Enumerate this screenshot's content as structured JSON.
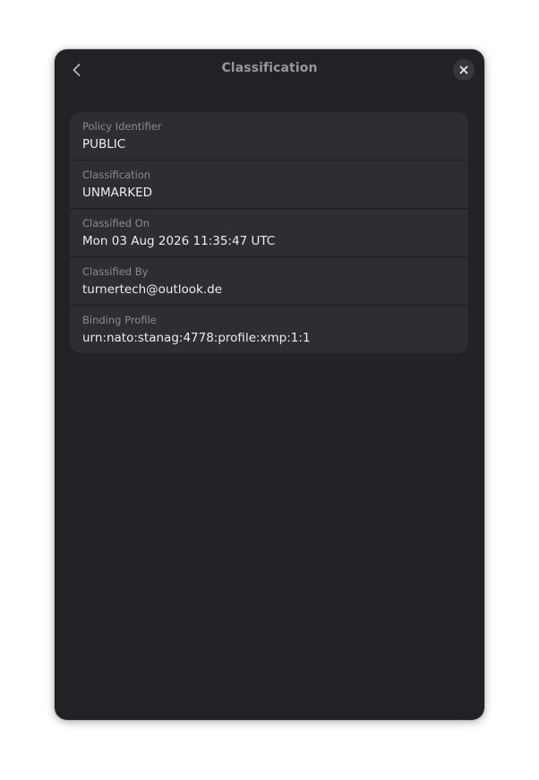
{
  "dialog": {
    "title": "Classification",
    "back_icon": "chevron-left-icon",
    "close_icon": "close-icon"
  },
  "rows": [
    {
      "label": "Policy Identifier",
      "value": "PUBLIC"
    },
    {
      "label": "Classification",
      "value": "UNMARKED"
    },
    {
      "label": "Classified On",
      "value": "Mon 03 Aug 2026 11:35:47 UTC"
    },
    {
      "label": "Classified By",
      "value": "turnertech@outlook.de"
    },
    {
      "label": "Binding Profile",
      "value": "urn:nato:stanag:4778:profile:xmp:1:1"
    }
  ],
  "colors": {
    "dialog_bg": "#222226",
    "card_bg": "#2e2e32",
    "label": "#8c8c90",
    "value": "#ececee",
    "title": "#98989c"
  }
}
